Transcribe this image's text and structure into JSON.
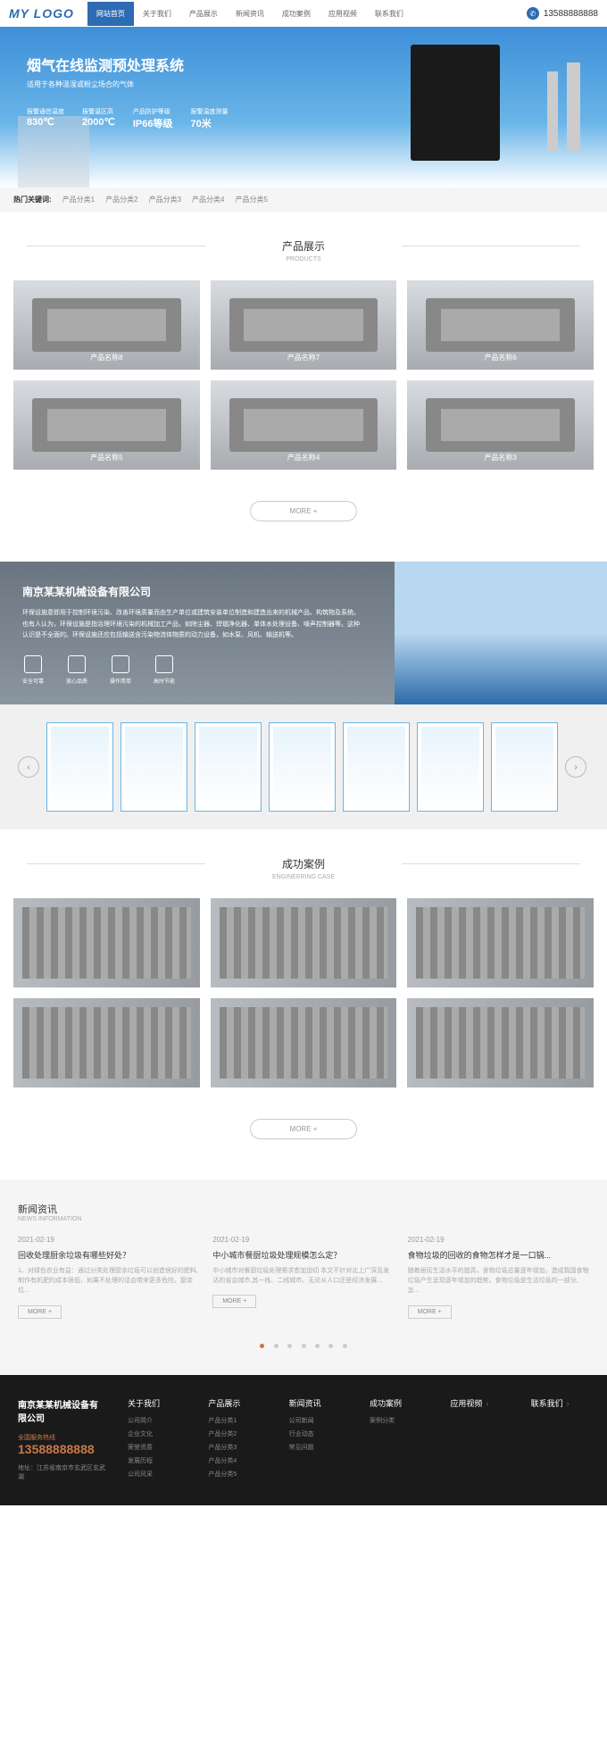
{
  "header": {
    "logo": "MY LOGO",
    "nav": [
      "网站首页",
      "关于我们",
      "产品展示",
      "新闻资讯",
      "成功案例",
      "应用视频",
      "联系我们"
    ],
    "phone": "13588888888"
  },
  "banner": {
    "title": "烟气在线监测预处理系统",
    "sub": "适用于各种温湿或粉尘场合的气体",
    "specs": [
      {
        "label": "报警通信温度",
        "val": "830℃"
      },
      {
        "label": "报警温区高",
        "val": "2000℃"
      },
      {
        "label": "产品防护等级",
        "val": "IP66等级"
      },
      {
        "label": "报警温度测量",
        "val": "70米"
      }
    ]
  },
  "hotbar": {
    "label": "热门关键词:",
    "items": [
      "产品分类1",
      "产品分类2",
      "产品分类3",
      "产品分类4",
      "产品分类5"
    ]
  },
  "products_section": {
    "title": "产品展示",
    "sub": "PRODUCTS",
    "items": [
      "产品名称8",
      "产品名称7",
      "产品名称6",
      "产品名称5",
      "产品名称4",
      "产品名称3"
    ],
    "more": "MORE +"
  },
  "about": {
    "title": "南京某某机械设备有限公司",
    "text": "环保设施意即用于控制环境污染、改善环境质量而由生产单位或建筑安装单位制造和建造出来的机械产品、构筑物及系统。也有人认为，环保设施是指治理环境污染的机械加工产品，如除尘器、焊烟净化器、单体水处理设备、噪声控制器等。这种认识是不全面的。环保设施还应包括输送含污染物流体物质的动力设备，如水泵、风机、输送机等。",
    "icons": [
      "安全可靠",
      "放心品质",
      "操作简单",
      "高时节能"
    ]
  },
  "cases_section": {
    "title": "成功案例",
    "sub": "ENGINEERING CASE",
    "more": "MORE +"
  },
  "news_section": {
    "header": "新闻资讯",
    "header_sub": "NEWS INFORMATION",
    "items": [
      {
        "date": "2021-02-19",
        "title": "回收处理厨余垃圾有哪些好处？",
        "desc": "1、对绿色农业有益：通过分类处理厨余垃圾可以创造很好的肥料,制作有机肥的成本很低，如果不处理的话会带来更多危险。厨余垃...",
        "more": "MORE +"
      },
      {
        "date": "2021-02-19",
        "title": "中小城市餐厨垃圾处理规模怎么定？",
        "desc": "中小城市对餐厨垃圾处理需求愈加迫切 本文不针对北上广深及发达的省会城市,其一线、二线城市、无论从人口还是经济发展...",
        "more": "MORE +"
      },
      {
        "date": "2021-02-19",
        "title": "食物垃圾的回收的食物怎样才是一口锅...",
        "desc": "随着居民生活水平的提高，食物垃圾总量逐年增加。造成我国食物垃圾产生呈现逐年增加的趋势。食物垃圾是生活垃圾的一部分,怎...",
        "more": "MORE +"
      }
    ]
  },
  "footer": {
    "company": "南京某某机械设备有限公司",
    "hotline_label": "全国服务热线",
    "hotline": "13588888888",
    "addr": "地址：江苏省南京市玄武区玄武湖",
    "cols": [
      {
        "title": "关于我们",
        "links": [
          "公司简介",
          "企业文化",
          "荣誉资质",
          "发展历程",
          "公司风采"
        ]
      },
      {
        "title": "产品展示",
        "links": [
          "产品分类1",
          "产品分类2",
          "产品分类3",
          "产品分类4",
          "产品分类5"
        ]
      },
      {
        "title": "新闻资讯",
        "links": [
          "公司新闻",
          "行业动态",
          "常见问题"
        ]
      },
      {
        "title": "成功案例",
        "links": [
          "案例分类"
        ]
      },
      {
        "title": "应用视频",
        "links": []
      },
      {
        "title": "联系我们",
        "links": []
      }
    ]
  }
}
